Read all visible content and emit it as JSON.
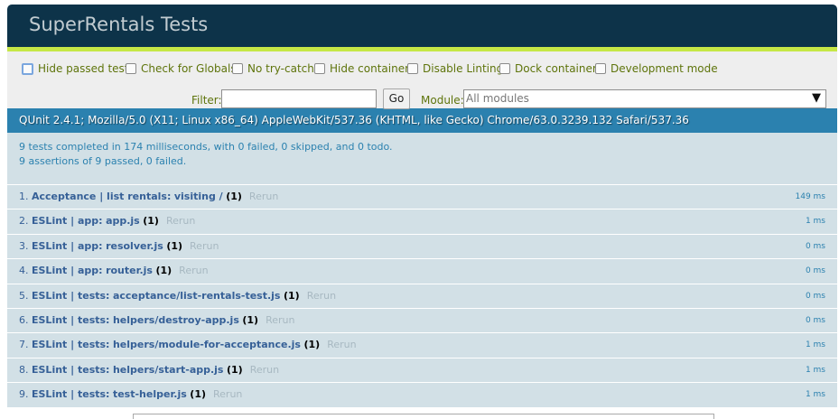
{
  "header": {
    "title": "SuperRentals Tests"
  },
  "toolbar": {
    "options": [
      {
        "label": "Hide passed tests"
      },
      {
        "label": "Check for Globals"
      },
      {
        "label": "No try-catch"
      },
      {
        "label": "Hide container"
      },
      {
        "label": "Disable Linting"
      },
      {
        "label": "Dock container"
      },
      {
        "label": "Development mode"
      }
    ],
    "filter_label": "Filter:",
    "filter_value": "",
    "go_label": "Go",
    "module_label": "Module:",
    "module_value": "All modules"
  },
  "user_agent": "QUnit 2.4.1; Mozilla/5.0 (X11; Linux x86_64) AppleWebKit/537.36 (KHTML, like Gecko) Chrome/63.0.3239.132 Safari/537.36",
  "summary": {
    "line1": "9 tests completed in 174 milliseconds, with 0 failed, 0 skipped, and 0 todo.",
    "line2": "9 assertions of 9 passed, 0 failed."
  },
  "tests": [
    {
      "num": "1.",
      "module": "Acceptance | list rentals:",
      "name": "visiting /",
      "counts": "(1)",
      "rerun": "Rerun",
      "runtime": "149 ms"
    },
    {
      "num": "2.",
      "module": "ESLint | app:",
      "name": "app.js",
      "counts": "(1)",
      "rerun": "Rerun",
      "runtime": "1 ms"
    },
    {
      "num": "3.",
      "module": "ESLint | app:",
      "name": "resolver.js",
      "counts": "(1)",
      "rerun": "Rerun",
      "runtime": "0 ms"
    },
    {
      "num": "4.",
      "module": "ESLint | app:",
      "name": "router.js",
      "counts": "(1)",
      "rerun": "Rerun",
      "runtime": "0 ms"
    },
    {
      "num": "5.",
      "module": "ESLint | tests:",
      "name": "acceptance/list-rentals-test.js",
      "counts": "(1)",
      "rerun": "Rerun",
      "runtime": "0 ms"
    },
    {
      "num": "6.",
      "module": "ESLint | tests:",
      "name": "helpers/destroy-app.js",
      "counts": "(1)",
      "rerun": "Rerun",
      "runtime": "0 ms"
    },
    {
      "num": "7.",
      "module": "ESLint | tests:",
      "name": "helpers/module-for-acceptance.js",
      "counts": "(1)",
      "rerun": "Rerun",
      "runtime": "1 ms"
    },
    {
      "num": "8.",
      "module": "ESLint | tests:",
      "name": "helpers/start-app.js",
      "counts": "(1)",
      "rerun": "Rerun",
      "runtime": "1 ms"
    },
    {
      "num": "9.",
      "module": "ESLint | tests:",
      "name": "test-helper.js",
      "counts": "(1)",
      "rerun": "Rerun",
      "runtime": "1 ms"
    }
  ]
}
